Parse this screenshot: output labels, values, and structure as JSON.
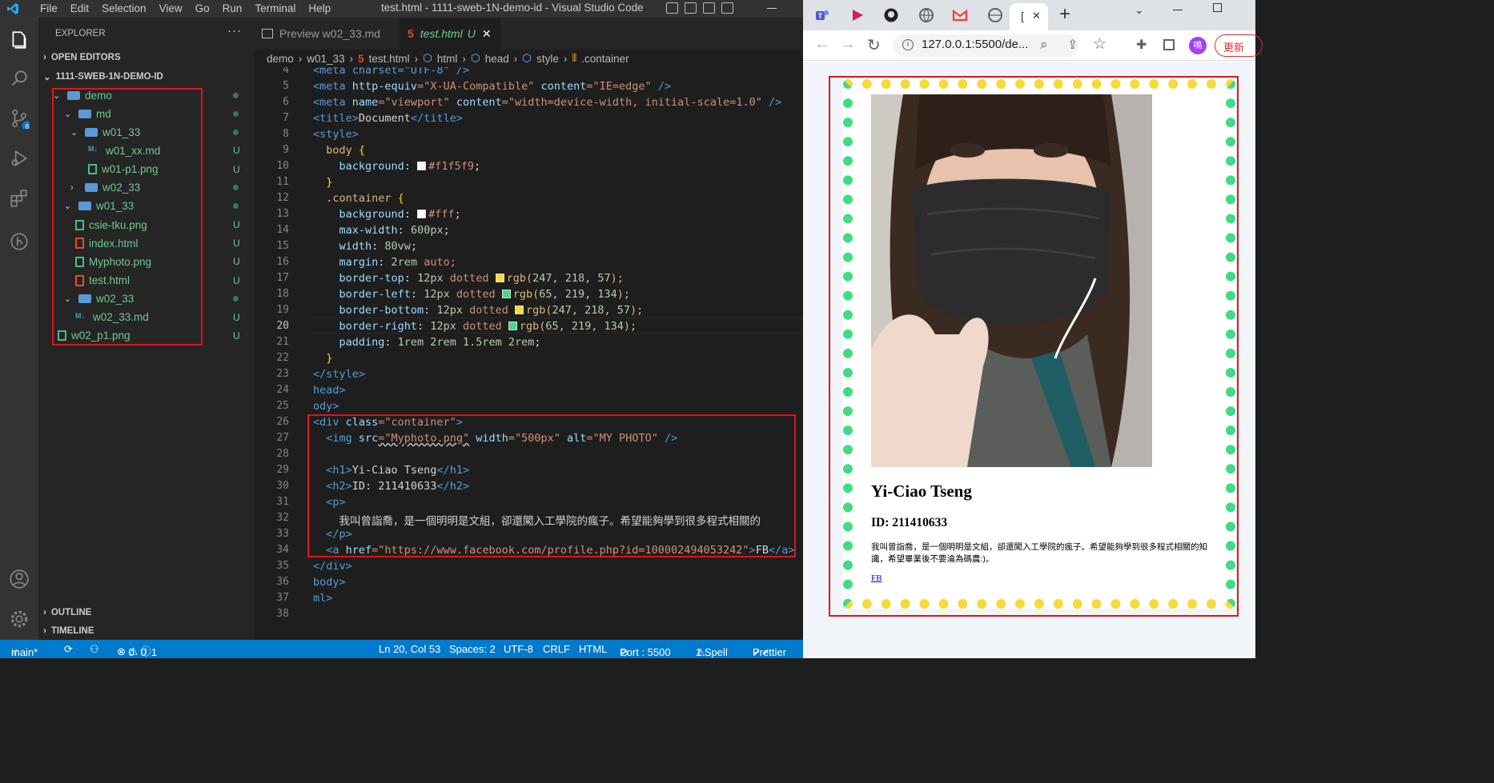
{
  "vscode": {
    "menu": [
      "File",
      "Edit",
      "Selection",
      "View",
      "Go",
      "Run",
      "Terminal",
      "Help"
    ],
    "window_title": "test.html - 1111-sweb-1N-demo-id - Visual Studio Code",
    "explorer": {
      "header": "EXPLORER",
      "more": "···",
      "open_editors": "OPEN EDITORS",
      "project": "1111-SWEB-1N-DEMO-ID",
      "tree": [
        {
          "label": "demo",
          "type": "folder",
          "status": ""
        },
        {
          "label": "md",
          "type": "folder",
          "status": ""
        },
        {
          "label": "w01_33",
          "type": "folder",
          "status": ""
        },
        {
          "label": "w01_xx.md",
          "type": "md",
          "status": "U"
        },
        {
          "label": "w01-p1.png",
          "type": "png",
          "status": "U"
        },
        {
          "label": "w02_33",
          "type": "folder",
          "status": ""
        },
        {
          "label": "w01_33",
          "type": "folder",
          "status": ""
        },
        {
          "label": "csie-tku.png",
          "type": "png",
          "status": "U"
        },
        {
          "label": "index.html",
          "type": "html",
          "status": "U"
        },
        {
          "label": "Myphoto.png",
          "type": "png",
          "status": "U"
        },
        {
          "label": "test.html",
          "type": "html",
          "status": "U"
        },
        {
          "label": "w02_33",
          "type": "folder",
          "status": ""
        },
        {
          "label": "w02_33.md",
          "type": "md",
          "status": "U"
        },
        {
          "label": "w02_p1.png",
          "type": "png",
          "status": "U"
        }
      ],
      "outline": "OUTLINE",
      "timeline": "TIMELINE",
      "scm_badge": "8"
    },
    "tabs": [
      {
        "label": "Preview w02_33.md"
      },
      {
        "label": "test.html",
        "badge": "U",
        "close": "✕"
      }
    ],
    "breadcrumb": [
      "demo",
      "w01_33",
      "test.html",
      "html",
      "head",
      "style",
      ".container"
    ],
    "line_numbers": [
      "4",
      "5",
      "6",
      "7",
      "8",
      "9",
      "10",
      "11",
      "12",
      "13",
      "14",
      "15",
      "16",
      "17",
      "18",
      "19",
      "20",
      "21",
      "22",
      "23",
      "24",
      "25",
      "26",
      "27",
      "28",
      "29",
      "30",
      "31",
      "32",
      "33",
      "34",
      "35",
      "36",
      "37",
      "38"
    ],
    "code": {
      "l4": "<meta charset=\"UTF-8\" />",
      "l5a": "<meta ",
      "l5b": "http-equiv",
      "l5c": "=\"X-UA-Compatible\"",
      "l5d": " content",
      "l5e": "=\"IE=edge\"",
      "l5f": " />",
      "l6a": "<meta ",
      "l6b": "name",
      "l6c": "=\"viewport\"",
      "l6d": " content",
      "l6e": "=\"width=device-width, initial-scale=1.0\"",
      "l6f": " />",
      "l7a": "<title>",
      "l7b": "Document",
      "l7c": "</title>",
      "l8": "<style>",
      "l9a": "  body ",
      "l9b": "{",
      "l10a": "    background",
      "l10b": ": ",
      "l10c": "#f1f5f9",
      "l10d": ";",
      "l11": "  }",
      "l12a": "  .container ",
      "l12b": "{",
      "l13a": "    background",
      "l13b": ": ",
      "l13c": "#fff",
      "l13d": ";",
      "l14a": "    max-width",
      "l14b": ": ",
      "l14c": "600px",
      "l14d": ";",
      "l15a": "    width",
      "l15b": ": ",
      "l15c": "80vw",
      "l15d": ";",
      "l16a": "    margin",
      "l16b": ": ",
      "l16c": "2rem",
      "l16d": " auto;",
      "l17a": "    border-top",
      "l17b": ": ",
      "l17c": "12px",
      "l17d": " dotted ",
      "l17e": "rgb(",
      "l17f": "247, 218, 57",
      "l17g": ");",
      "l18a": "    border-left",
      "l18b": ": ",
      "l18c": "12px",
      "l18d": " dotted ",
      "l18e": "rgb(",
      "l18f": "65, 219, 134",
      "l18g": ");",
      "l19a": "    border-bottom",
      "l19b": ": ",
      "l19c": "12px",
      "l19d": " dotted ",
      "l19e": "rgb(",
      "l19f": "247, 218, 57",
      "l19g": ");",
      "l20a": "    border-right",
      "l20b": ": ",
      "l20c": "12px",
      "l20d": " dotted ",
      "l20e": "rgb(",
      "l20f": "65, 219, 134",
      "l20g": ");",
      "l21a": "    padding",
      "l21b": ": ",
      "l21c": "1rem 2rem 1.5rem 2rem",
      "l21d": ";",
      "l22": "  }",
      "l23": "</style>",
      "l24": "head>",
      "l25": "ody>",
      "l26a": "<div ",
      "l26b": "class",
      "l26c": "=\"container\"",
      "l26d": ">",
      "l27a": "  <img ",
      "l27b": "src",
      "l27c": "=\"Myphoto.png\"",
      "l27d": " width",
      "l27e": "=\"500px\"",
      "l27f": " alt",
      "l27g": "=\"MY PHOTO\"",
      "l27h": " />",
      "l29a": "  <h1>",
      "l29b": "Yi-Ciao Tseng",
      "l29c": "</h1>",
      "l30a": "  <h2>",
      "l30b": "ID: 211410633",
      "l30c": "</h2>",
      "l31": "  <p>",
      "l32": "    我叫曾詣喬，是一個明明是文組，卻還闖入工學院的瘋子。希望能夠學到很多程式相關的",
      "l33": "  </p>",
      "l34a": "  <a ",
      "l34b": "href",
      "l34c": "=\"https://www.facebook.com/profile.php?id=100002494053242\"",
      "l34d": ">",
      "l34e": "FB",
      "l34f": "</a>",
      "l35": "</div>",
      "l36": "body>",
      "l37": "ml>"
    },
    "colors": {
      "swatch_f1f5f9": "#f1f5f9",
      "swatch_fff": "#ffffff",
      "swatch_yellow": "rgb(247, 218, 57)",
      "swatch_green": "rgb(65, 219, 134)",
      "statusbar": "#007acc",
      "highlight_box": "#e0141a"
    },
    "status": {
      "branch": "main*",
      "errors": "0",
      "warnings": "0",
      "info": "1",
      "position": "Ln 20, Col 53",
      "spaces": "Spaces: 2",
      "encoding": "UTF-8",
      "eol": "CRLF",
      "language": "HTML",
      "port": "Port : 5500",
      "spell": "1 Spell",
      "prettier": "Prettier"
    }
  },
  "browser": {
    "new_tab": "+",
    "tab_label": "[",
    "tab_close": "✕",
    "url": "127.0.0.1:5500/de...",
    "update_button": "更新",
    "profile_initial": "鳴",
    "page": {
      "alt": "MY PHOTO",
      "h1": "Yi-Ciao Tseng",
      "h2": "ID: 211410633",
      "paragraph": "我叫曾詣喬，是一個明明是文組，卻還闖入工學院的瘋子。希望能夠學到很多程式相關的知識，希望畢業後不要淪為碼農:)。",
      "link": "FB"
    }
  }
}
